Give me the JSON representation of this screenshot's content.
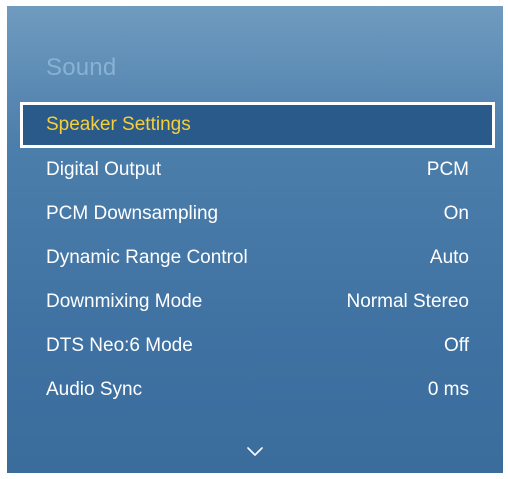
{
  "menu": {
    "title": "Sound",
    "items": [
      {
        "label": "Speaker Settings",
        "value": ""
      },
      {
        "label": "Digital Output",
        "value": "PCM"
      },
      {
        "label": "PCM Downsampling",
        "value": "On"
      },
      {
        "label": "Dynamic Range Control",
        "value": "Auto"
      },
      {
        "label": "Downmixing Mode",
        "value": "Normal Stereo"
      },
      {
        "label": "DTS Neo:6 Mode",
        "value": "Off"
      },
      {
        "label": "Audio Sync",
        "value": "0 ms"
      }
    ],
    "scroll_indicator_icon": "chevron-down-icon"
  },
  "colors": {
    "panel_top": "#6f9bbf",
    "panel_bottom": "#3a6c9c",
    "focus_background": "#2a5a8a",
    "focus_border": "#ffffff",
    "focus_text": "#f6cf3a",
    "title_text": "#87b2d4",
    "text": "#ffffff"
  }
}
